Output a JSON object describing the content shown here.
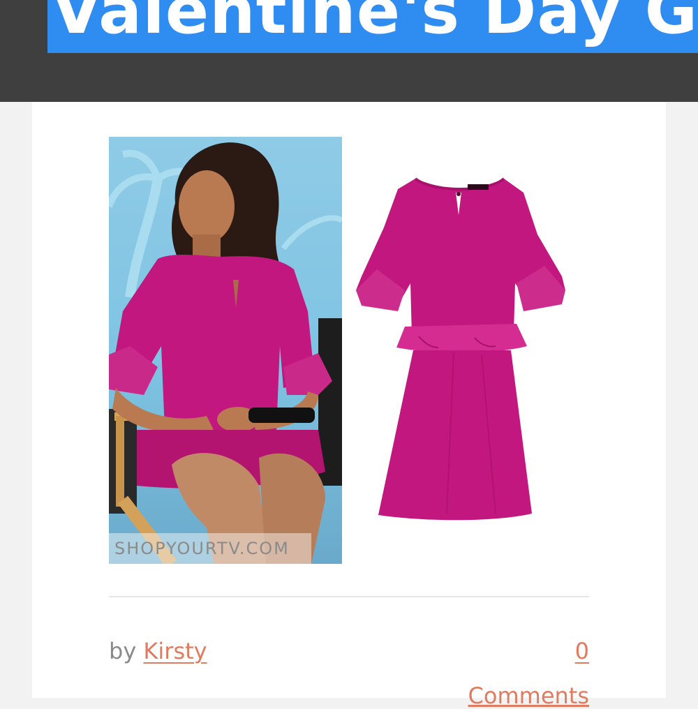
{
  "header": {
    "title": "Valentine's Day Gi"
  },
  "post": {
    "photo_watermark": "SHOPYOURTV.COM",
    "byline_prefix": "by",
    "author": "Kirsty",
    "comments_count": "0",
    "comments_label": "Comments"
  },
  "colors": {
    "header_bg": "#3f3f3f",
    "title_highlight": "#2f8cf0",
    "link": "#e07b5f",
    "dress": "#c2177f"
  }
}
